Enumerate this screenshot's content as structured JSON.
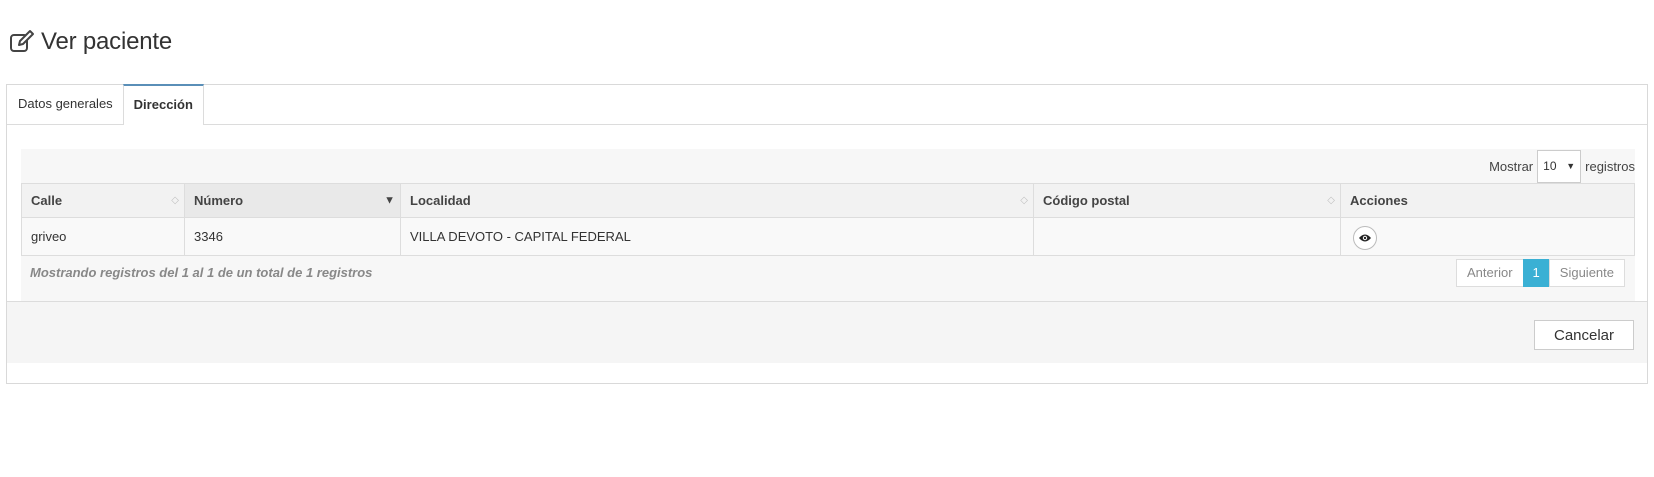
{
  "page": {
    "title": "Ver paciente",
    "title_icon": "edit-icon"
  },
  "tabs": [
    {
      "label": "Datos generales",
      "active": false
    },
    {
      "label": "Dirección",
      "active": true
    }
  ],
  "table": {
    "length": {
      "prefix": "Mostrar",
      "value": "10",
      "suffix": "registros"
    },
    "columns": [
      {
        "label": "Calle",
        "sort": "none"
      },
      {
        "label": "Número",
        "sort": "desc"
      },
      {
        "label": "Localidad",
        "sort": "none"
      },
      {
        "label": "Código postal",
        "sort": "none"
      },
      {
        "label": "Acciones",
        "sort": ""
      }
    ],
    "rows": [
      {
        "calle": "griveo",
        "numero": "3346",
        "localidad": "VILLA DEVOTO - CAPITAL FEDERAL",
        "codigo_postal": "",
        "action_icon": "eye-icon"
      }
    ],
    "info": "Mostrando registros del 1 al 1 de un total de 1 registros",
    "pagination": {
      "prev": "Anterior",
      "current": "1",
      "next": "Siguiente"
    }
  },
  "footer": {
    "cancel_label": "Cancelar"
  },
  "colors": {
    "tab_accent": "#5a8fb8",
    "page_active": "#3ab0d4"
  }
}
